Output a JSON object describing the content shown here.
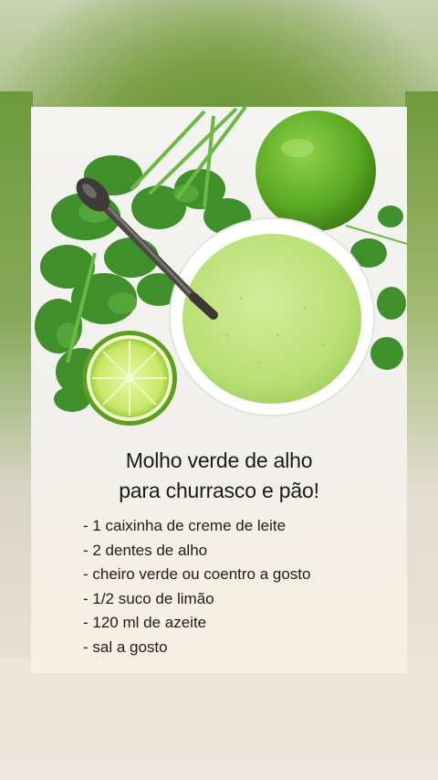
{
  "recipe": {
    "title_line1": "Molho verde de alho",
    "title_line2": "para churrasco e pão!",
    "ingredients": [
      "- 1 caixinha de creme de leite",
      "- 2 dentes de alho",
      "- cheiro verde ou coentro a gosto",
      "- 1/2 suco de limão",
      "- 120 ml de azeite",
      "- sal a gosto"
    ]
  },
  "colors": {
    "sauce": "#b9e07a",
    "lime": "#6fbf2c",
    "cilantro": "#3f8f2a",
    "bowl": "#ffffff"
  }
}
